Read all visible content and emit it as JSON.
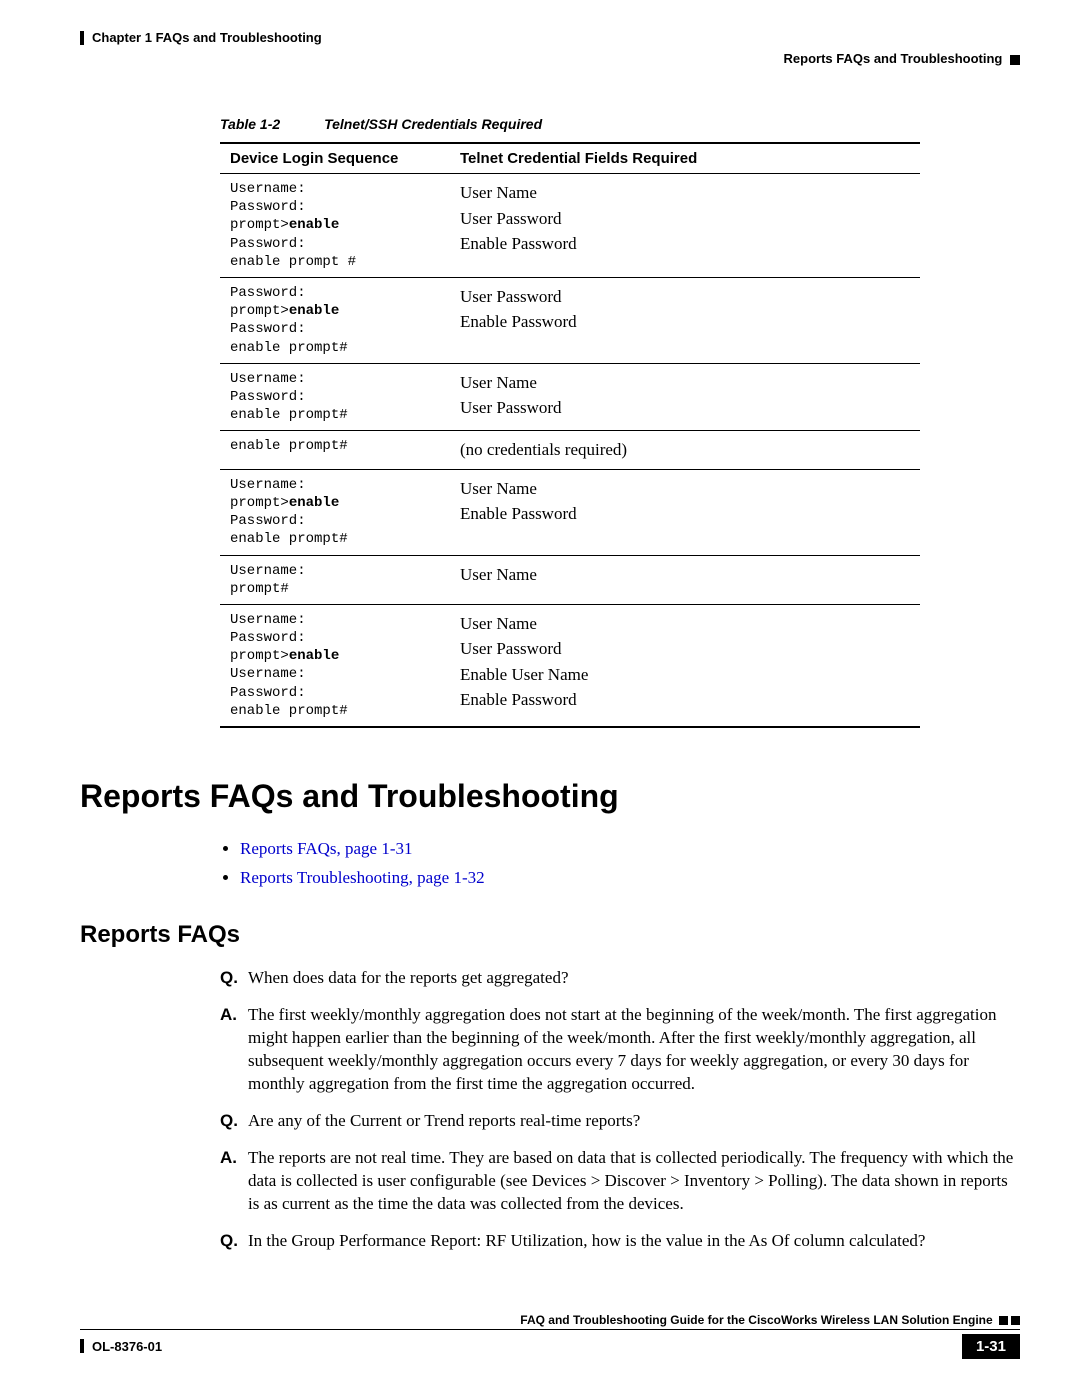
{
  "header": {
    "chapter": "Chapter 1      FAQs and Troubleshooting",
    "section": "Reports FAQs and Troubleshooting"
  },
  "table": {
    "caption_num": "Table 1-2",
    "caption_title": "Telnet/SSH Credentials Required",
    "col1": "Device Login Sequence",
    "col2": "Telnet Credential Fields Required",
    "rows": [
      {
        "seq_html": "Username:\nPassword:\nprompt><b>enable</b>\nPassword:\nenable prompt #",
        "fields": "User Name\nUser Password\nEnable Password"
      },
      {
        "seq_html": "Password:\nprompt><b>enable</b>\nPassword:\nenable prompt#",
        "fields": "User Password\nEnable Password"
      },
      {
        "seq_html": "Username:\nPassword:\nenable prompt#",
        "fields": "User Name\nUser Password"
      },
      {
        "seq_html": "enable prompt#",
        "fields": "(no credentials required)"
      },
      {
        "seq_html": "Username:\nprompt><b>enable</b>\nPassword:\nenable prompt#",
        "fields": "User Name\nEnable Password"
      },
      {
        "seq_html": "Username:\nprompt#",
        "fields": "User Name"
      },
      {
        "seq_html": "Username:\nPassword:\nprompt><b>enable</b>\nUsername:\nPassword:\nenable prompt#",
        "fields": "User Name\nUser Password\nEnable User Name\nEnable Password"
      }
    ]
  },
  "section_heading": "Reports FAQs and Troubleshooting",
  "links": [
    "Reports FAQs, page 1-31",
    "Reports Troubleshooting, page 1-32"
  ],
  "subsection_heading": "Reports FAQs",
  "qa": [
    {
      "label": "Q.",
      "text": "When does data for the reports get aggregated?"
    },
    {
      "label": "A.",
      "text": "The first weekly/monthly aggregation does not start at the beginning of the week/month. The first aggregation might happen earlier than the beginning of the week/month. After the first weekly/monthly aggregation, all subsequent weekly/monthly aggregation occurs every 7 days for weekly aggregation, or every 30 days for monthly aggregation from the first time the aggregation occurred."
    },
    {
      "label": "Q.",
      "text": "Are any of the Current or Trend reports real-time reports?"
    },
    {
      "label": "A.",
      "text": "The reports are not real time. They are based on data that is collected periodically. The frequency with which the data is collected is user configurable (see Devices > Discover > Inventory > Polling). The data shown in reports is as current as the time the data was collected from the devices."
    },
    {
      "label": "Q.",
      "text": "In the Group Performance Report: RF Utilization, how is the value in the As Of column calculated?"
    }
  ],
  "footer": {
    "guide": "FAQ and Troubleshooting Guide for the CiscoWorks Wireless LAN Solution Engine",
    "docnum": "OL-8376-01",
    "pagenum": "1-31"
  }
}
